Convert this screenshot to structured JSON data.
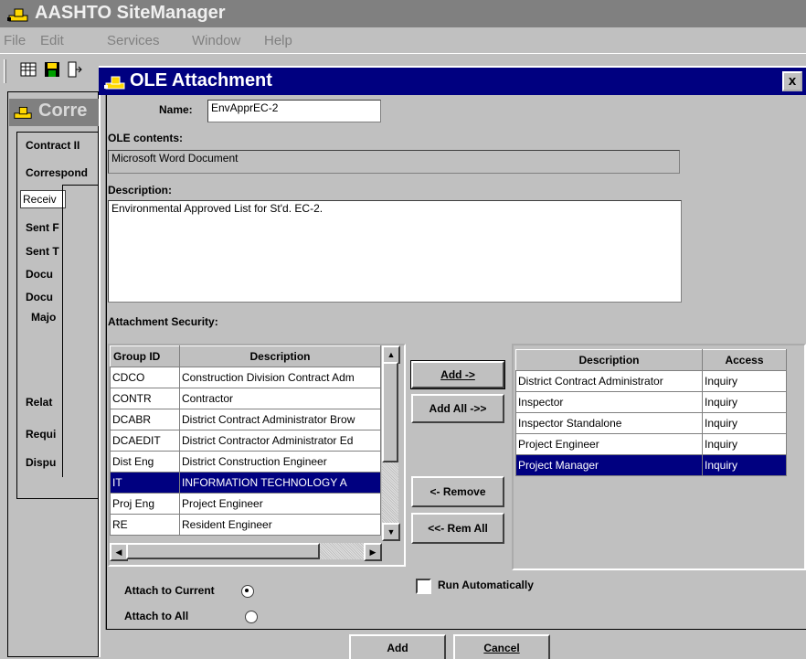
{
  "app": {
    "title": "AASHTO SiteManager",
    "menu": [
      "File",
      "Edit",
      "Services",
      "Window",
      "Help"
    ]
  },
  "bg_window": {
    "title": "Corre",
    "labels": [
      "Contract II",
      "Correspond",
      "Sent F",
      "Sent T",
      "Docu",
      "Docu",
      "Majo",
      "Relat",
      "Requi",
      "Dispu"
    ],
    "received_value": "Receiv"
  },
  "dialog": {
    "title": "OLE Attachment",
    "close": "x",
    "name_label": "Name:",
    "name_value": "EnvApprEC-2",
    "ole_contents_label": "OLE contents:",
    "ole_contents_value": "Microsoft Word Document",
    "description_label": "Description:",
    "description_value": "Environmental Approved List for St'd. EC-2.",
    "security_label": "Attachment Security:",
    "available": {
      "headers": [
        "Group ID",
        "Description"
      ],
      "rows": [
        [
          "CDCO",
          "Construction Division Contract Adm"
        ],
        [
          "CONTR",
          "Contractor"
        ],
        [
          "DCABR",
          "District Contract Administrator Brow"
        ],
        [
          "DCAEDIT",
          "District Contractor Administrator Ed"
        ],
        [
          "Dist Eng",
          "District Construction Engineer"
        ],
        [
          "IT",
          "INFORMATION TECHNOLOGY A"
        ],
        [
          "Proj Eng",
          "Project Engineer"
        ],
        [
          "RE",
          "Resident Engineer"
        ]
      ],
      "selected_index": 5
    },
    "assigned": {
      "headers": [
        "Description",
        "Access"
      ],
      "rows": [
        [
          "District Contract Administrator",
          "Inquiry"
        ],
        [
          "Inspector",
          "Inquiry"
        ],
        [
          "Inspector Standalone",
          "Inquiry"
        ],
        [
          "Project Engineer",
          "Inquiry"
        ],
        [
          "Project Manager",
          "Inquiry"
        ]
      ],
      "selected_index": 4
    },
    "buttons": {
      "add_arrow": "Add ->",
      "add_all": "Add All ->>",
      "remove": "<- Remove",
      "rem_all": "<<- Rem All",
      "add": "Add",
      "cancel": "Cancel"
    },
    "attach_current_label": "Attach to Current",
    "attach_all_label": "Attach to All",
    "attach_choice": "current",
    "run_auto_label": "Run Automatically",
    "run_auto_checked": false
  }
}
